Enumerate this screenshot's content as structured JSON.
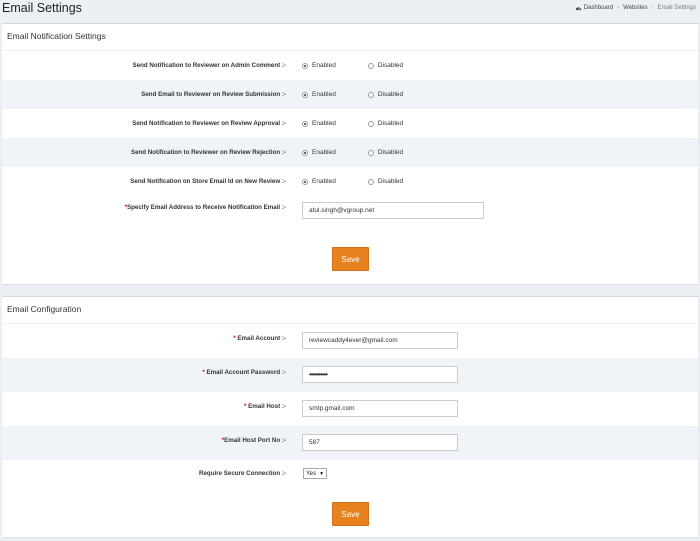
{
  "header": {
    "title": "Email Settings",
    "breadcrumb": [
      "Dashboard",
      "Websites",
      "Email Settings"
    ]
  },
  "notification_settings": {
    "title": "Email Notification Settings",
    "rows": [
      {
        "label": "Send Notification to Reviewer on Admin Comment :-",
        "enabled_label": "Enabled",
        "disabled_label": "Disabled",
        "selected": "Enabled"
      },
      {
        "label": "Send Email to Reviewer on Review Submission :-",
        "enabled_label": "Enabled",
        "disabled_label": "Disabled",
        "selected": "Enabled"
      },
      {
        "label": "Send Notification to Reviewer on Review Approval :-",
        "enabled_label": "Enabled",
        "disabled_label": "Disabled",
        "selected": "Enabled"
      },
      {
        "label": "Send Notification to Reviewer on Review Rejection :-",
        "enabled_label": "Enabled",
        "disabled_label": "Disabled",
        "selected": "Enabled"
      },
      {
        "label": "Send Notification on Store Email Id on New Review :-",
        "enabled_label": "Enabled",
        "disabled_label": "Disabled",
        "selected": "Enabled"
      }
    ],
    "email_address": {
      "required": "*",
      "label": "Specify Email Address to Receive Notification Email :-",
      "value": "atul.singh@vgroup.net"
    },
    "save_label": "Save"
  },
  "email_configuration": {
    "title": "Email Configuration",
    "account": {
      "required": "*",
      "label": " Email Account :-",
      "value": "reviewcaddy4ever@gmail.com"
    },
    "password": {
      "required": "*",
      "label": " Email Account Password :-",
      "value": "••••••••••"
    },
    "host": {
      "required": "*",
      "label": " Email Host :-",
      "value": "smtp.gmail.com"
    },
    "port": {
      "required": "*",
      "label": "Email Host Port No :-",
      "value": "587"
    },
    "secure": {
      "label": "Require Secure Connection :-",
      "value": "Yes"
    },
    "save_label": "Save"
  },
  "colors": {
    "accent": "#e8821f",
    "stripe": "#f0f4f8"
  }
}
